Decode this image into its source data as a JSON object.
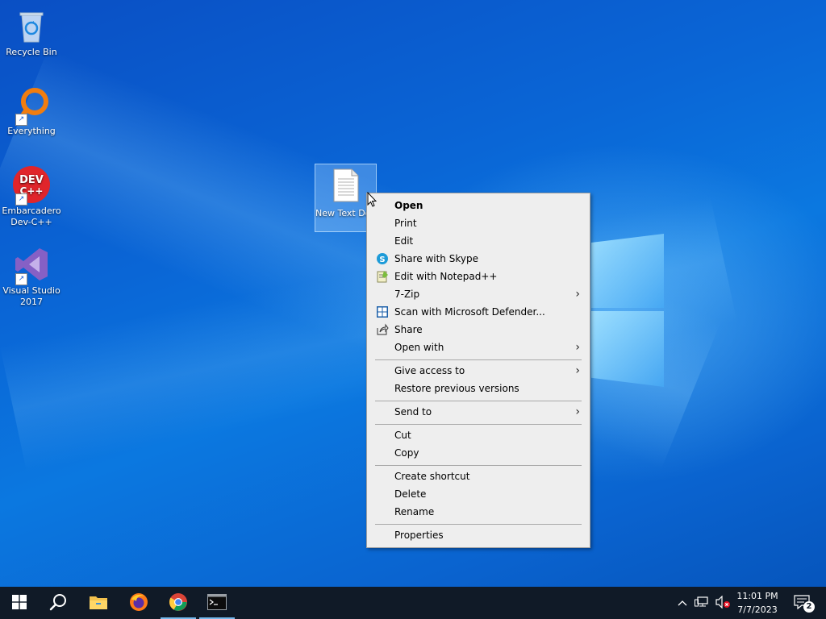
{
  "desktop": {
    "icons": [
      {
        "label": "Recycle Bin"
      },
      {
        "label": "Everything"
      },
      {
        "label": "Embarcadero Dev-C++",
        "badge": "DEV C++"
      },
      {
        "label": "Visual Studio 2017"
      }
    ],
    "selected_file": {
      "label": "New Text Document",
      "icon": "text-file-icon"
    }
  },
  "context_menu": {
    "items": [
      {
        "label": "Open",
        "bold": true
      },
      {
        "label": "Print"
      },
      {
        "label": "Edit"
      },
      {
        "label": "Share with Skype",
        "icon": "skype-icon"
      },
      {
        "label": "Edit with Notepad++",
        "icon": "notepad-plus-plus-icon"
      },
      {
        "label": "7-Zip",
        "submenu": true
      },
      {
        "label": "Scan with Microsoft Defender...",
        "icon": "defender-icon"
      },
      {
        "label": "Share",
        "icon": "share-icon"
      },
      {
        "label": "Open with",
        "submenu": true
      },
      {
        "label": "Give access to",
        "submenu": true
      },
      {
        "label": "Restore previous versions"
      },
      {
        "label": "Send to",
        "submenu": true
      },
      {
        "label": "Cut"
      },
      {
        "label": "Copy"
      },
      {
        "label": "Create shortcut"
      },
      {
        "label": "Delete"
      },
      {
        "label": "Rename"
      },
      {
        "label": "Properties"
      }
    ]
  },
  "taskbar": {
    "buttons": [
      "start-icon",
      "search-icon",
      "file-explorer-icon",
      "firefox-icon",
      "chrome-icon",
      "terminal-icon"
    ],
    "clock": {
      "time": "11:01 PM",
      "date": "7/7/2023"
    },
    "notification_count": "2"
  },
  "colors": {
    "accent": "#0a66d6",
    "taskbar": "#101a27",
    "menu_bg": "#eeeeee"
  }
}
